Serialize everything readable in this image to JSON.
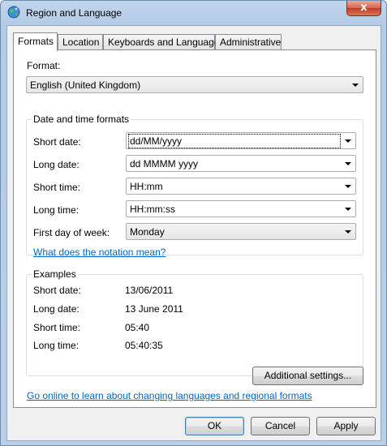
{
  "window": {
    "title": "Region and Language",
    "close_symbol": "x"
  },
  "tabs": [
    {
      "label": "Formats",
      "active": true
    },
    {
      "label": "Location",
      "active": false
    },
    {
      "label": "Keyboards and Languages",
      "active": false
    },
    {
      "label": "Administrative",
      "active": false
    }
  ],
  "format": {
    "label": "Format:",
    "value": "English (United Kingdom)"
  },
  "datetime": {
    "title": "Date and time formats",
    "short_date": {
      "label": "Short date:",
      "value": "dd/MM/yyyy"
    },
    "long_date": {
      "label": "Long date:",
      "value": "dd MMMM yyyy"
    },
    "short_time": {
      "label": "Short time:",
      "value": "HH:mm"
    },
    "long_time": {
      "label": "Long time:",
      "value": "HH:mm:ss"
    },
    "first_day": {
      "label": "First day of week:",
      "value": "Monday"
    },
    "notation_link": "What does the notation mean?"
  },
  "examples": {
    "title": "Examples",
    "short_date": {
      "label": "Short date:",
      "value": "13/06/2011"
    },
    "long_date": {
      "label": "Long date:",
      "value": "13 June 2011"
    },
    "short_time": {
      "label": "Short time:",
      "value": "05:40"
    },
    "long_time": {
      "label": "Long time:",
      "value": "05:40:35"
    }
  },
  "additional_settings": "Additional settings...",
  "online_link": "Go online to learn about changing languages and regional formats",
  "buttons": {
    "ok": "OK",
    "cancel": "Cancel",
    "apply": "Apply"
  },
  "icons": {
    "app": "globe-icon",
    "close": "close-icon",
    "dropdown": "chevron-down-icon"
  }
}
